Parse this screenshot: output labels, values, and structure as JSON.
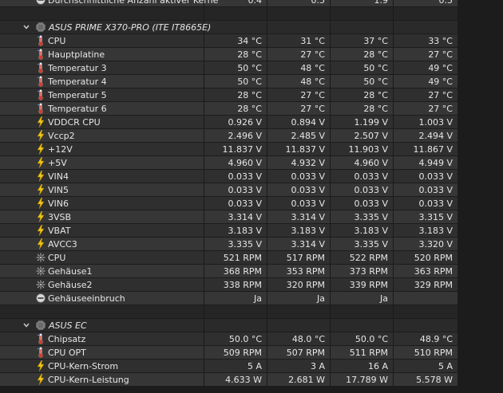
{
  "top_row": {
    "label": "Durchschnittliche Anzahl aktiver Kerne",
    "values": [
      "0.4",
      "0.5",
      "1.9",
      "0.5"
    ]
  },
  "groups": [
    {
      "title": "ASUS PRIME X370-PRO (ITE IT8665E)",
      "rows": [
        {
          "icon": "thermometer-icon",
          "label": "CPU",
          "values": [
            "34 °C",
            "31 °C",
            "37 °C",
            "33 °C"
          ]
        },
        {
          "icon": "thermometer-icon",
          "label": "Hauptplatine",
          "values": [
            "28 °C",
            "27 °C",
            "28 °C",
            "27 °C"
          ]
        },
        {
          "icon": "thermometer-icon",
          "label": "Temperatur 3",
          "values": [
            "50 °C",
            "48 °C",
            "50 °C",
            "49 °C"
          ]
        },
        {
          "icon": "thermometer-icon",
          "label": "Temperatur 4",
          "values": [
            "50 °C",
            "48 °C",
            "50 °C",
            "49 °C"
          ]
        },
        {
          "icon": "thermometer-icon",
          "label": "Temperatur 5",
          "values": [
            "28 °C",
            "27 °C",
            "28 °C",
            "27 °C"
          ]
        },
        {
          "icon": "thermometer-icon",
          "label": "Temperatur 6",
          "values": [
            "28 °C",
            "27 °C",
            "28 °C",
            "27 °C"
          ]
        },
        {
          "icon": "lightning-icon",
          "label": "VDDCR CPU",
          "values": [
            "0.926 V",
            "0.894 V",
            "1.199 V",
            "1.003 V"
          ]
        },
        {
          "icon": "lightning-icon",
          "label": "Vccp2",
          "values": [
            "2.496 V",
            "2.485 V",
            "2.507 V",
            "2.494 V"
          ]
        },
        {
          "icon": "lightning-icon",
          "label": "+12V",
          "values": [
            "11.837 V",
            "11.837 V",
            "11.903 V",
            "11.867 V"
          ]
        },
        {
          "icon": "lightning-icon",
          "label": "+5V",
          "values": [
            "4.960 V",
            "4.932 V",
            "4.960 V",
            "4.949 V"
          ]
        },
        {
          "icon": "lightning-icon",
          "label": "VIN4",
          "values": [
            "0.033 V",
            "0.033 V",
            "0.033 V",
            "0.033 V"
          ]
        },
        {
          "icon": "lightning-icon",
          "label": "VIN5",
          "values": [
            "0.033 V",
            "0.033 V",
            "0.033 V",
            "0.033 V"
          ]
        },
        {
          "icon": "lightning-icon",
          "label": "VIN6",
          "values": [
            "0.033 V",
            "0.033 V",
            "0.033 V",
            "0.033 V"
          ]
        },
        {
          "icon": "lightning-icon",
          "label": "3VSB",
          "values": [
            "3.314 V",
            "3.314 V",
            "3.335 V",
            "3.315 V"
          ]
        },
        {
          "icon": "lightning-icon",
          "label": "VBAT",
          "values": [
            "3.183 V",
            "3.183 V",
            "3.183 V",
            "3.183 V"
          ]
        },
        {
          "icon": "lightning-icon",
          "label": "AVCC3",
          "values": [
            "3.335 V",
            "3.314 V",
            "3.335 V",
            "3.320 V"
          ]
        },
        {
          "icon": "fan-icon",
          "label": "CPU",
          "values": [
            "521 RPM",
            "517 RPM",
            "522 RPM",
            "520 RPM"
          ]
        },
        {
          "icon": "fan-icon",
          "label": "Gehäuse1",
          "values": [
            "368 RPM",
            "353 RPM",
            "373 RPM",
            "363 RPM"
          ]
        },
        {
          "icon": "fan-icon",
          "label": "Gehäuse2",
          "values": [
            "338 RPM",
            "320 RPM",
            "339 RPM",
            "329 RPM"
          ]
        },
        {
          "icon": "intrusion-icon",
          "label": "Gehäuseeinbruch",
          "values": [
            "Ja",
            "Ja",
            "Ja",
            ""
          ]
        }
      ]
    },
    {
      "title": "ASUS EC",
      "rows": [
        {
          "icon": "thermometer-icon",
          "label": "Chipsatz",
          "values": [
            "50.0 °C",
            "48.0 °C",
            "50.0 °C",
            "48.9 °C"
          ]
        },
        {
          "icon": "thermometer-icon",
          "label": "CPU OPT",
          "values": [
            "509 RPM",
            "507 RPM",
            "511 RPM",
            "510 RPM"
          ]
        },
        {
          "icon": "lightning-icon",
          "label": "CPU-Kern-Strom",
          "values": [
            "5 A",
            "3 A",
            "16 A",
            "5 A"
          ]
        },
        {
          "icon": "lightning-icon",
          "label": "CPU-Kern-Leistung",
          "values": [
            "4.633 W",
            "2.681 W",
            "17.789 W",
            "5.578 W"
          ]
        }
      ]
    }
  ],
  "colors": {
    "thermo_red": "#d83a2c",
    "thermo_blue": "#5a8fd8",
    "bolt_yellow": "#f0c419",
    "fan_grey": "#b8b8b8"
  }
}
